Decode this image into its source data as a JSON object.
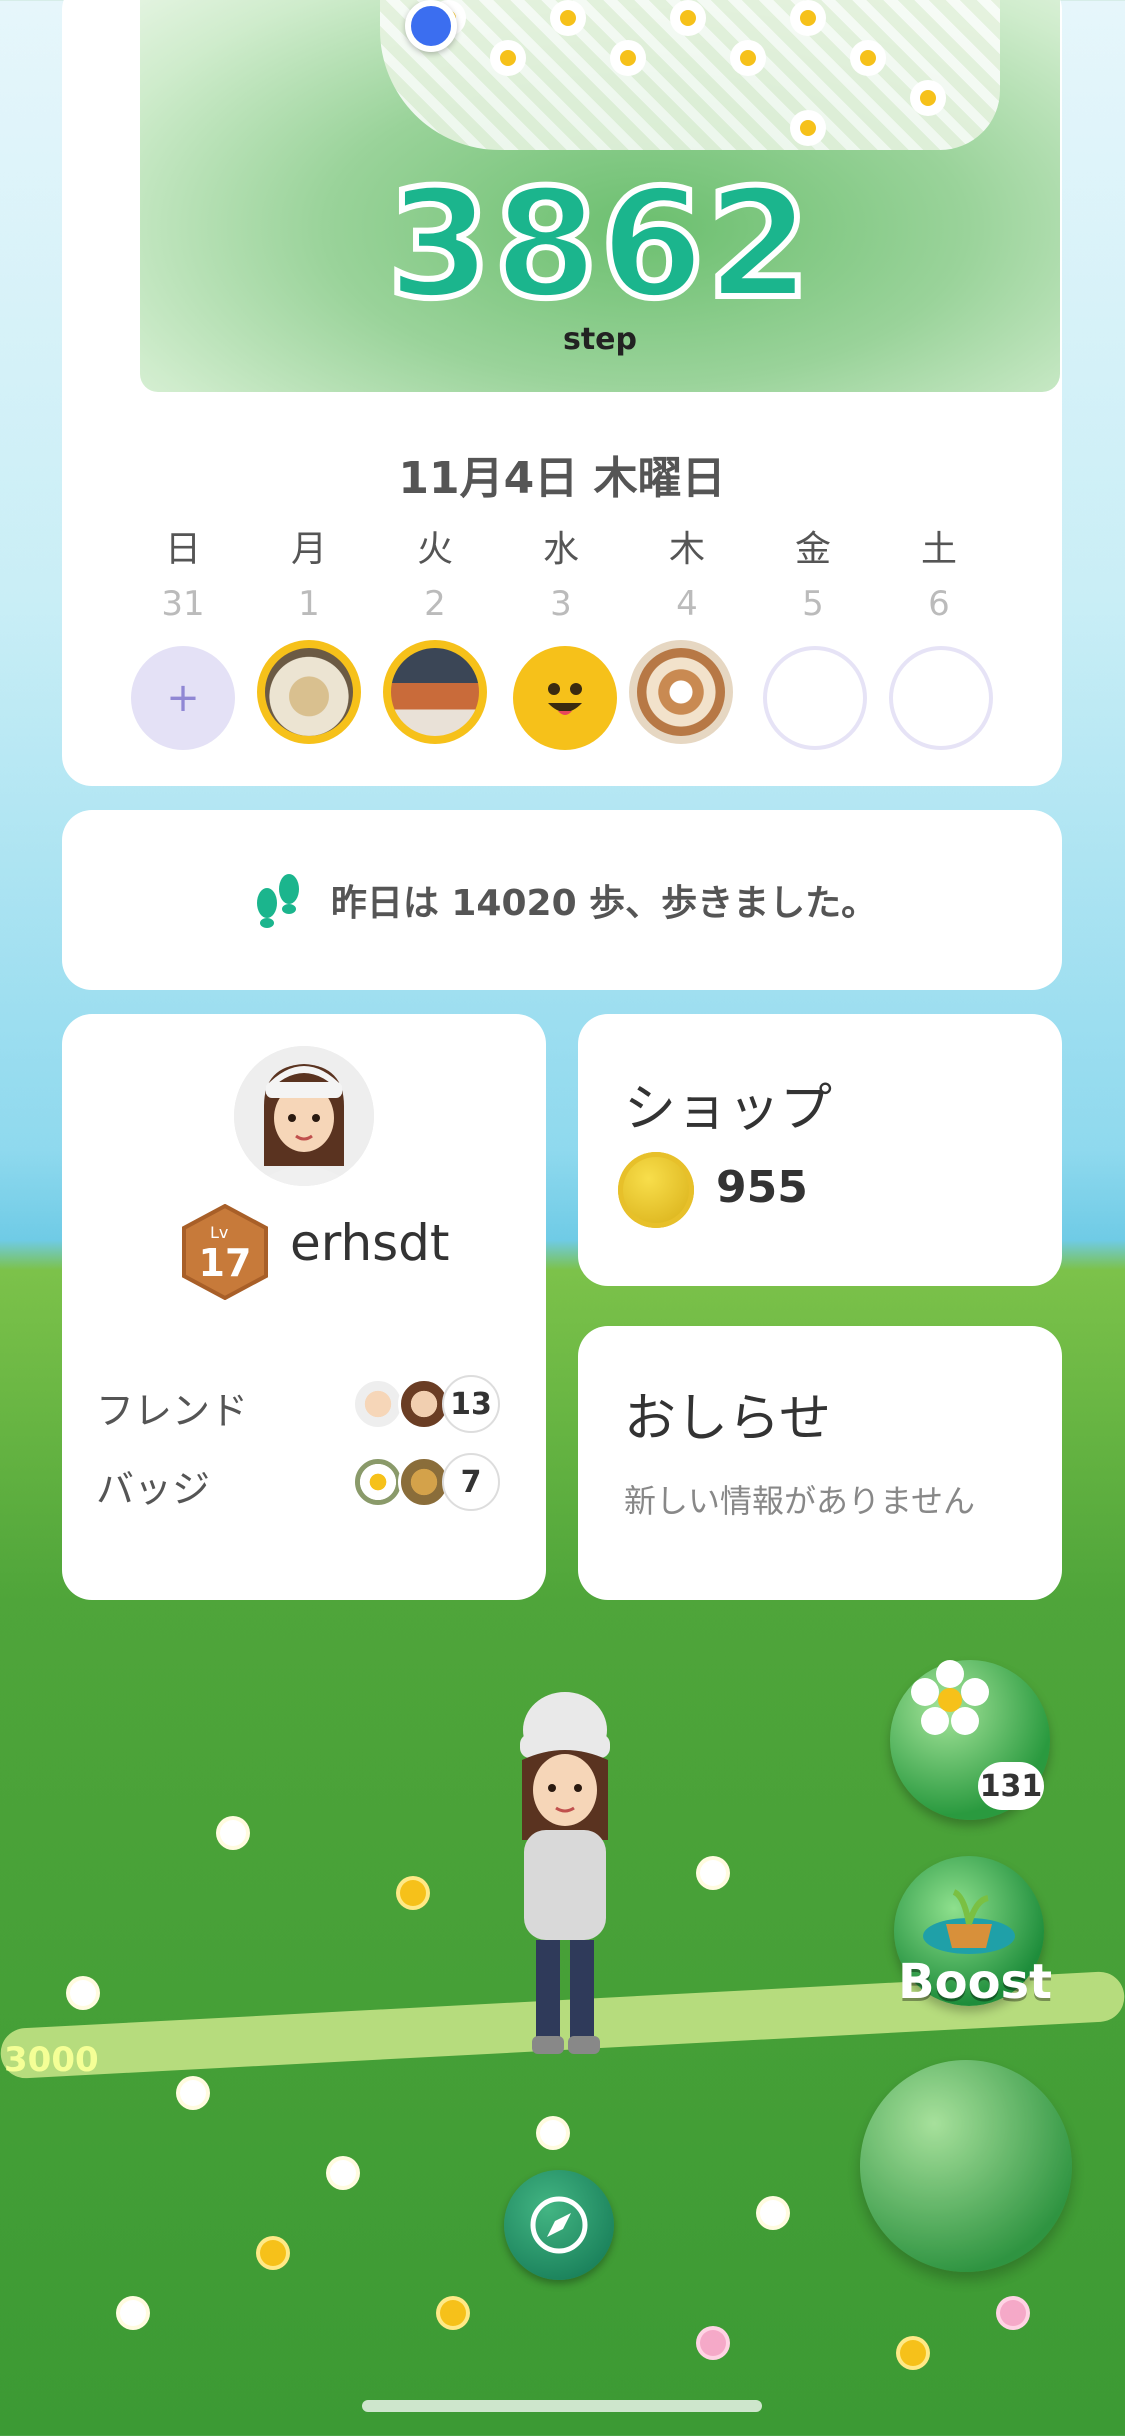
{
  "header": {
    "steps_today": "3862",
    "steps_unit": "step"
  },
  "calendar": {
    "date_title": "11月4日 木曜日",
    "days": [
      {
        "weekday": "日",
        "date": "31",
        "state": "add"
      },
      {
        "weekday": "月",
        "date": "1",
        "state": "photo"
      },
      {
        "weekday": "火",
        "date": "2",
        "state": "photo"
      },
      {
        "weekday": "水",
        "date": "3",
        "state": "emoji"
      },
      {
        "weekday": "木",
        "date": "4",
        "state": "photo"
      },
      {
        "weekday": "金",
        "date": "5",
        "state": "empty"
      },
      {
        "weekday": "土",
        "date": "6",
        "state": "empty"
      }
    ],
    "add_label": "+"
  },
  "yesterday": {
    "message": "昨日は 14020 歩、歩きました。"
  },
  "profile": {
    "username": "erhsdt",
    "level_prefix": "Lv",
    "level": "17",
    "friends_label": "フレンド",
    "friends_count": "13",
    "badges_label": "バッジ",
    "badges_count": "7"
  },
  "shop": {
    "title": "ショップ",
    "coins": "955"
  },
  "news": {
    "title": "おしらせ",
    "empty_message": "新しい情報がありません"
  },
  "game": {
    "flower_count": "131",
    "boost_label": "Boost",
    "path_marker": "3000"
  },
  "colors": {
    "step_green": "#1bb58d",
    "day_ring_yellow": "#f6c11a",
    "add_circle": "#e4e1f6",
    "card_bg": "#ffffff"
  }
}
